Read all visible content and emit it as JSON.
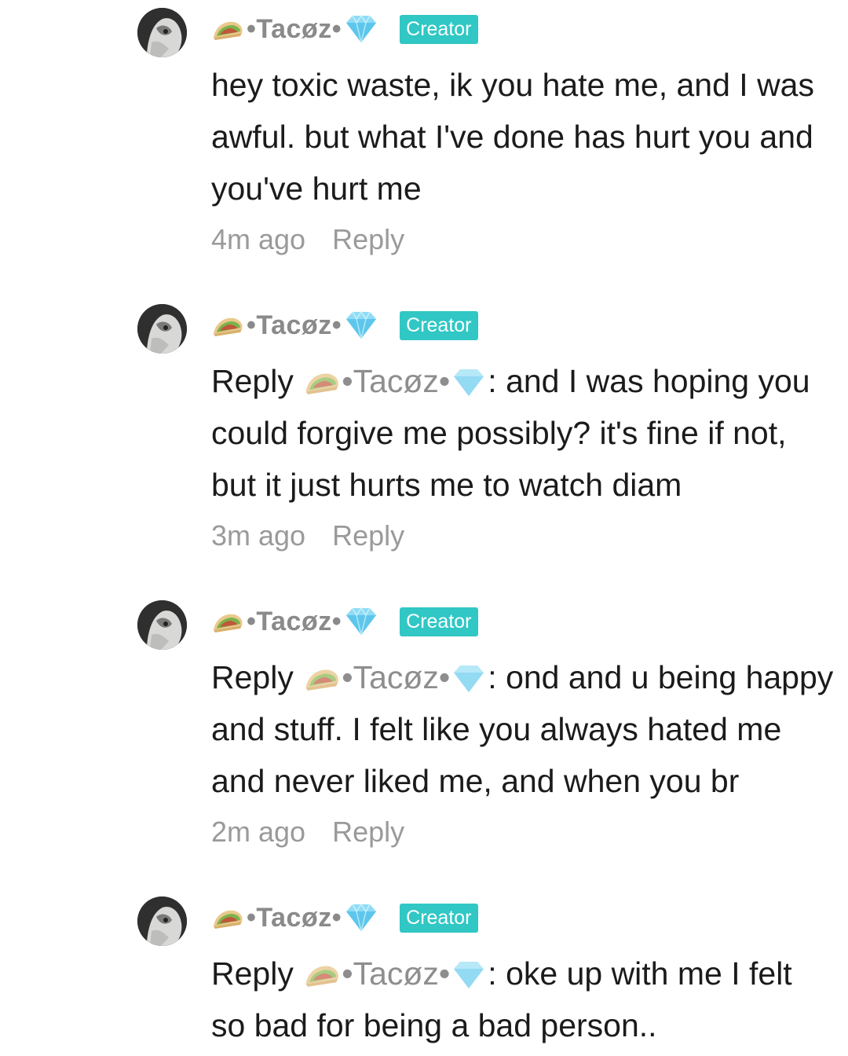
{
  "comments": [
    {
      "username": "•Tacøz•",
      "badge": "Creator",
      "lines": [
        {
          "text": "hey toxic waste, ik you hate me, and I was"
        },
        {
          "text": "awful. but what I've done has hurt you and"
        },
        {
          "text": "you've hurt me"
        }
      ],
      "time": "4m ago",
      "reply_label": "Reply"
    },
    {
      "username": "•Tacøz•",
      "badge": "Creator",
      "reply_prefix": "Reply",
      "reply_to": "•Tacøz•",
      "lines": [
        {
          "text": ": and I was hoping you"
        },
        {
          "text": "could forgive me possibly? it's fine if not,"
        },
        {
          "text": "but it just hurts me to watch diam"
        }
      ],
      "time": "3m ago",
      "reply_label": "Reply"
    },
    {
      "username": "•Tacøz•",
      "badge": "Creator",
      "reply_prefix": "Reply",
      "reply_to": "•Tacøz•",
      "lines": [
        {
          "text": ": ond and u being happy"
        },
        {
          "text": "and stuff. I felt like you always hated me"
        },
        {
          "text": "and never liked me, and when you br"
        }
      ],
      "time": "2m ago",
      "reply_label": "Reply"
    },
    {
      "username": "•Tacøz•",
      "badge": "Creator",
      "reply_prefix": "Reply",
      "reply_to": "•Tacøz•",
      "lines": [
        {
          "text": ": oke up with me I felt"
        },
        {
          "text": "so bad for being a bad person.."
        }
      ]
    }
  ],
  "icons": {
    "avatar": "avatar",
    "username_prefix": "taco-emoji-icon",
    "username_suffix": "gem-emoji-icon"
  },
  "colors": {
    "badge": "#30c7c4",
    "username": "#8a8a8a",
    "meta": "#9a9a9a",
    "text": "#1b1b1b"
  }
}
